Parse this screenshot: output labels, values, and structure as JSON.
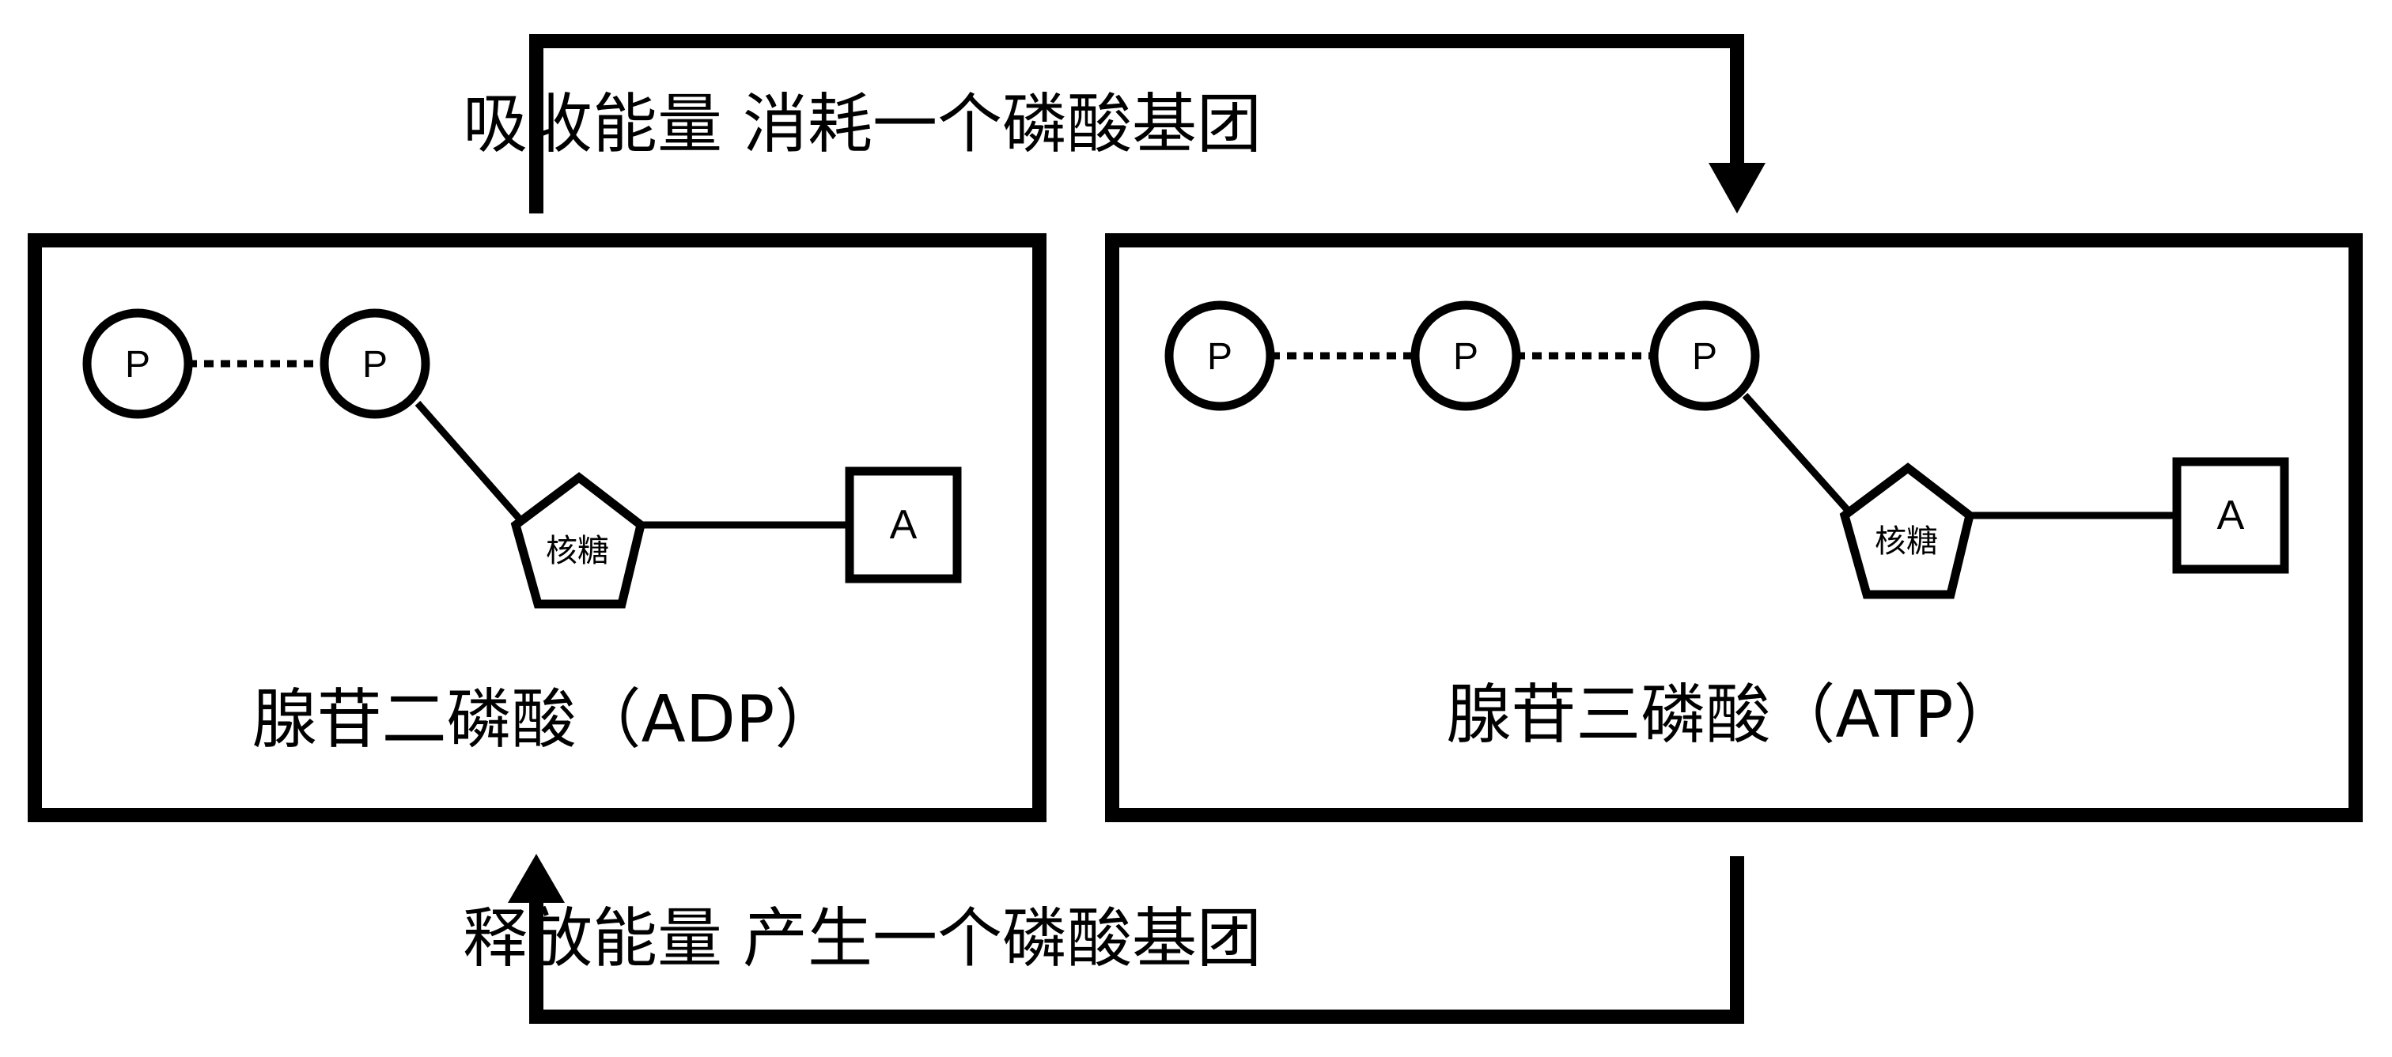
{
  "top_flow": {
    "label": "吸收能量 消耗一个磷酸基团"
  },
  "bottom_flow": {
    "label": "释放能量 产生一个磷酸基团"
  },
  "adp": {
    "title": "腺苷二磷酸（ADP）",
    "phosphates": [
      "P",
      "P"
    ],
    "sugar": "核糖",
    "base": "A"
  },
  "atp": {
    "title": "腺苷三磷酸（ATP）",
    "phosphates": [
      "P",
      "P",
      "P"
    ],
    "sugar": "核糖",
    "base": "A"
  },
  "colors": {
    "ink": "#000000",
    "background": "#ffffff"
  }
}
